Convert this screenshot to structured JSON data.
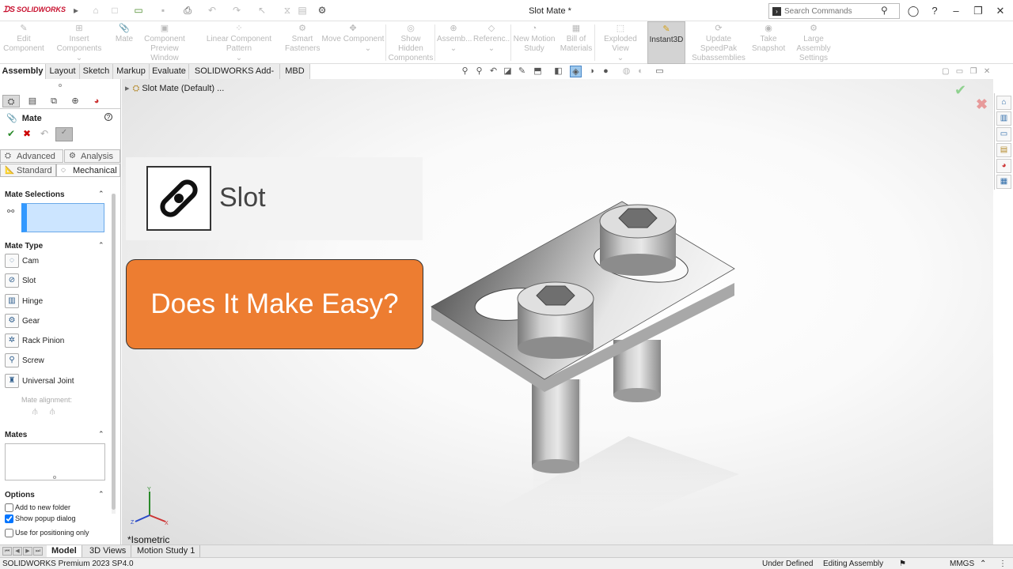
{
  "app": {
    "logo": "SOLIDWORKS",
    "title": "Slot Mate *"
  },
  "search": {
    "placeholder": "Search Commands"
  },
  "ribbon": [
    {
      "label1": "Edit",
      "label2": "Component",
      "icon": "edit-component-icon"
    },
    {
      "label1": "Insert Components",
      "label2": "",
      "icon": "insert-components-icon"
    },
    {
      "label1": "Mate",
      "label2": "",
      "icon": "mate-icon"
    },
    {
      "label1": "Component",
      "label2": "Preview Window",
      "icon": "preview-window-icon"
    },
    {
      "label1": "Linear Component Pattern",
      "label2": "",
      "icon": "pattern-icon"
    },
    {
      "label1": "Smart",
      "label2": "Fasteners",
      "icon": "smart-fasteners-icon"
    },
    {
      "label1": "Move Component",
      "label2": "",
      "icon": "move-component-icon"
    },
    {
      "label1": "Show Hidden",
      "label2": "Components",
      "icon": "show-hidden-icon"
    },
    {
      "label1": "Assemb...",
      "label2": "",
      "icon": "assembly-features-icon"
    },
    {
      "label1": "Referenc...",
      "label2": "",
      "icon": "reference-geometry-icon"
    },
    {
      "label1": "New Motion",
      "label2": "Study",
      "icon": "motion-study-icon"
    },
    {
      "label1": "Bill of",
      "label2": "Materials",
      "icon": "bom-icon"
    },
    {
      "label1": "Exploded View",
      "label2": "",
      "icon": "exploded-view-icon"
    },
    {
      "label1": "Instant3D",
      "label2": "",
      "icon": "instant3d-icon"
    },
    {
      "label1": "Update SpeedPak",
      "label2": "Subassemblies",
      "icon": "speedpak-icon"
    },
    {
      "label1": "Take",
      "label2": "Snapshot",
      "icon": "snapshot-icon"
    },
    {
      "label1": "Large Assembly",
      "label2": "Settings",
      "icon": "large-assembly-icon"
    }
  ],
  "cm_tabs": [
    "Assembly",
    "Layout",
    "Sketch",
    "Markup",
    "Evaluate",
    "SOLIDWORKS Add-Ins",
    "MBD"
  ],
  "pm": {
    "title": "Mate",
    "subtabs": {
      "advanced": "Advanced",
      "analysis": "Analysis",
      "standard": "Standard",
      "mechanical": "Mechanical"
    },
    "mate_selections": "Mate Selections",
    "mate_type": "Mate Type",
    "mate_types": [
      {
        "label": "Cam",
        "icon": "cam-icon"
      },
      {
        "label": "Slot",
        "icon": "slot-icon"
      },
      {
        "label": "Hinge",
        "icon": "hinge-icon"
      },
      {
        "label": "Gear",
        "icon": "gear-icon"
      },
      {
        "label": "Rack Pinion",
        "icon": "rack-pinion-icon"
      },
      {
        "label": "Screw",
        "icon": "screw-icon"
      },
      {
        "label": "Universal Joint",
        "icon": "universal-joint-icon"
      }
    ],
    "mate_alignment": "Mate alignment:",
    "mates": "Mates",
    "options": "Options",
    "opts": [
      {
        "label": "Add to new folder",
        "checked": false
      },
      {
        "label": "Show popup dialog",
        "checked": true
      },
      {
        "label": "Use for positioning only",
        "checked": false
      }
    ]
  },
  "viewport": {
    "tree_item": "Slot Mate (Default) ...",
    "slot_label": "Slot",
    "banner": "Does It Make Easy?",
    "view_label": "*Isometric"
  },
  "bottom_tabs": [
    "Model",
    "3D Views",
    "Motion Study 1"
  ],
  "status": {
    "version": "SOLIDWORKS Premium 2023 SP4.0",
    "defined": "Under Defined",
    "mode": "Editing Assembly",
    "units": "MMGS"
  },
  "colors": {
    "banner": "#ed7d31",
    "selection": "#cce5ff",
    "accent": "#3399ff"
  }
}
